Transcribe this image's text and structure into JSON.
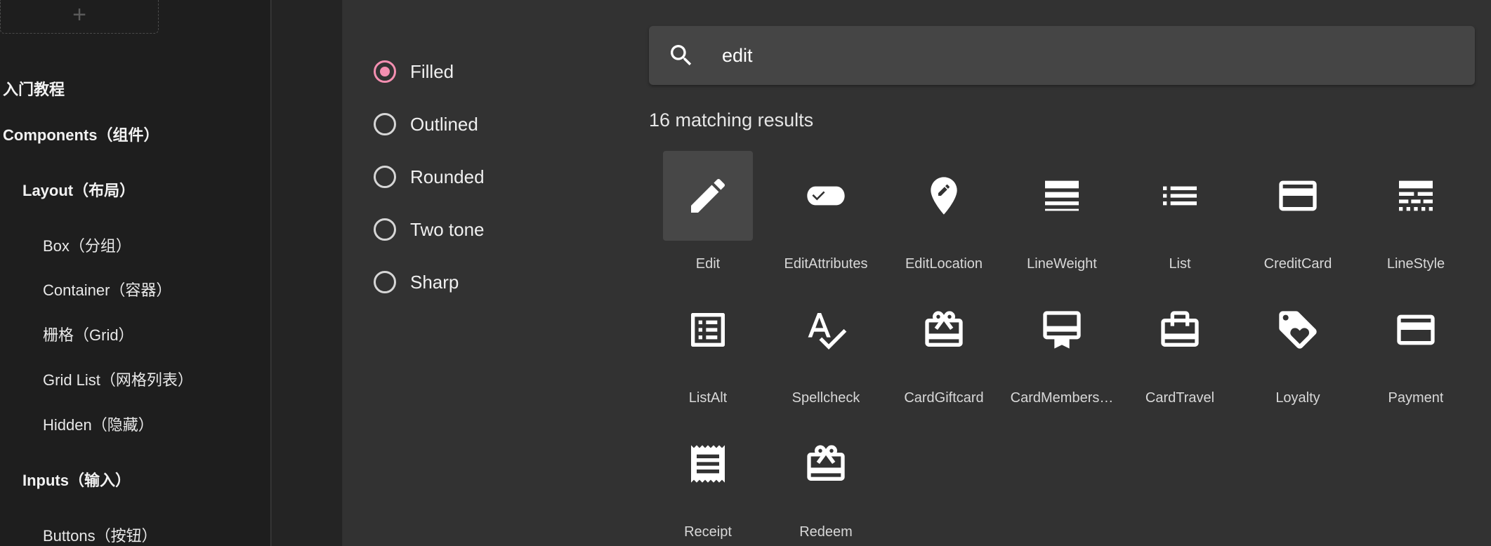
{
  "sidebar": {
    "add_symbol": "+",
    "items": [
      {
        "label": "入门教程",
        "level": 0
      },
      {
        "label": "Components（组件）",
        "level": 0
      },
      {
        "label": "Layout（布局）",
        "level": 1
      },
      {
        "label": "Box（分组）",
        "level": 2
      },
      {
        "label": "Container（容器）",
        "level": 2
      },
      {
        "label": "栅格（Grid）",
        "level": 2
      },
      {
        "label": "Grid List（网格列表）",
        "level": 2
      },
      {
        "label": "Hidden（隐藏）",
        "level": 2
      },
      {
        "label": "Inputs（输入）",
        "level": 1
      },
      {
        "label": "Buttons（按钮）",
        "level": 2
      }
    ]
  },
  "theme_options": {
    "selected": "Filled",
    "options": [
      "Filled",
      "Outlined",
      "Rounded",
      "Two tone",
      "Sharp"
    ],
    "accent_color": "#f48fb1"
  },
  "search": {
    "value": "edit",
    "icon": "search-icon"
  },
  "results": {
    "count_text": "16 matching results",
    "icons": [
      {
        "label": "Edit",
        "icon": "edit-icon",
        "hovered": true
      },
      {
        "label": "EditAttributes",
        "icon": "edit-attributes-icon"
      },
      {
        "label": "EditLocation",
        "icon": "edit-location-icon"
      },
      {
        "label": "LineWeight",
        "icon": "line-weight-icon"
      },
      {
        "label": "List",
        "icon": "list-icon"
      },
      {
        "label": "CreditCard",
        "icon": "credit-card-icon"
      },
      {
        "label": "LineStyle",
        "icon": "line-style-icon"
      },
      {
        "label": "ListAlt",
        "icon": "list-alt-icon"
      },
      {
        "label": "Spellcheck",
        "icon": "spellcheck-icon"
      },
      {
        "label": "CardGiftcard",
        "icon": "card-giftcard-icon"
      },
      {
        "label": "CardMembers…",
        "icon": "card-membership-icon"
      },
      {
        "label": "CardTravel",
        "icon": "card-travel-icon"
      },
      {
        "label": "Loyalty",
        "icon": "loyalty-icon"
      },
      {
        "label": "Payment",
        "icon": "payment-icon"
      },
      {
        "label": "Receipt",
        "icon": "receipt-icon"
      },
      {
        "label": "Redeem",
        "icon": "redeem-icon"
      }
    ]
  }
}
